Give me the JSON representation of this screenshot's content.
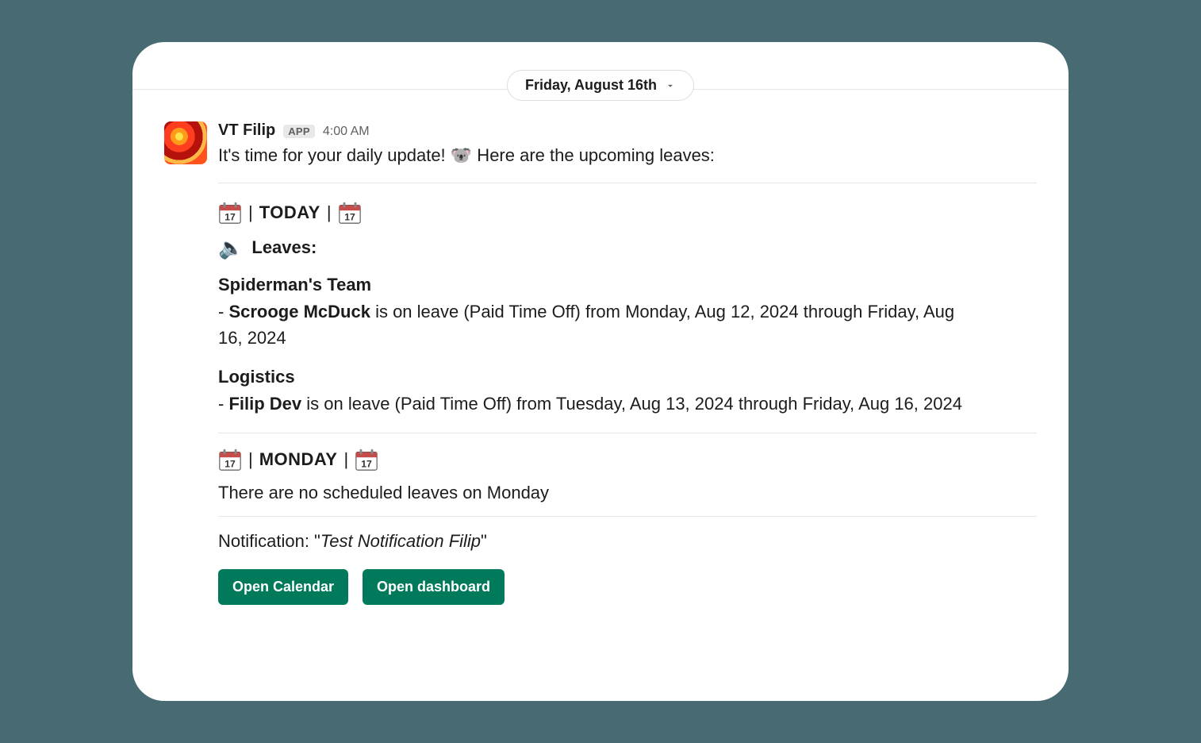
{
  "datePill": "Friday, August 16th",
  "sender": "VT Filip",
  "appBadge": "APP",
  "timestamp": "4:00 AM",
  "introPrefix": "It's time for your daily update! ",
  "introSuffix": " Here are the upcoming leaves:",
  "today": {
    "label": "TODAY",
    "leavesLabel": "Leaves:",
    "groups": [
      {
        "team": "Spiderman's Team",
        "prefix": "- ",
        "person": "Scrooge McDuck",
        "rest": " is on leave (Paid Time Off) from Monday, Aug 12, 2024 through Friday, Aug 16, 2024"
      },
      {
        "team": "Logistics",
        "prefix": "- ",
        "person": "Filip Dev",
        "rest": " is on leave (Paid Time Off) from Tuesday, Aug 13, 2024 through Friday, Aug 16, 2024"
      }
    ]
  },
  "monday": {
    "label": "MONDAY",
    "empty": "There are no scheduled leaves on Monday"
  },
  "notification": {
    "prefix": "Notification: \"",
    "name": "Test Notification Filip",
    "suffix": "\""
  },
  "buttons": {
    "calendar": "Open Calendar",
    "dashboard": "Open dashboard"
  }
}
